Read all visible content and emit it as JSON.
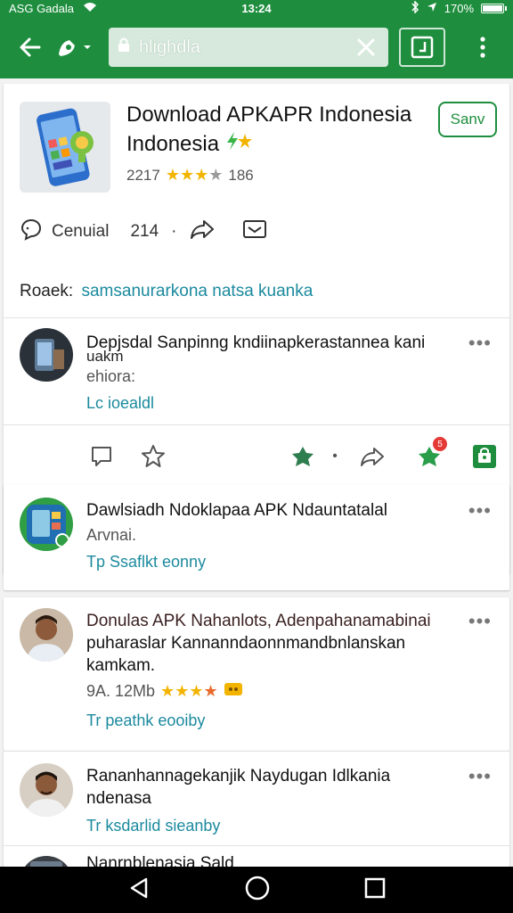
{
  "status_bar": {
    "carrier": "ASG Gadala",
    "time": "13:24",
    "battery": "170%"
  },
  "toolbar": {
    "url": "hlighdla"
  },
  "app": {
    "title_line1": "Download APKAPR Indonesia",
    "title_line2": "Indonesia",
    "rating_count": "2217",
    "rating_stars": 3,
    "rating_max": 5,
    "rating_extra": "186",
    "save_label": "Sanv",
    "comment_label": "Cenuial",
    "comment_count": "214",
    "read_label": "Roaek:",
    "read_link": "samsanurarkona natsa kuanka"
  },
  "posts": [
    {
      "title": "Depjsdal Sanpinng kndiinapkerastannea kani",
      "title2": "uakm",
      "sub": "ehiora:",
      "link": "Lc ioealdl"
    },
    {
      "title": "Dawlsiadh Ndoklapaa APK Ndauntatalal",
      "sub": "Arvnai.",
      "link": "Tp Ssaflkt eonny"
    },
    {
      "title": "Donulas APK Nahanlots, Adenpahanamabinai",
      "title2": "puharaslar Kannanndaonnmandbnlanskan",
      "title3": "kamkam.",
      "stats": "9A. 12Mb",
      "stars": 4,
      "link": "Tr peathk eooiby"
    },
    {
      "title": "Rananhannagekanjik Naydugan Idlkania",
      "title2": "ndenasa",
      "link": "Tr ksdarlid sieanby"
    },
    {
      "title": "Nanrnblenasia Sald"
    }
  ],
  "colors": {
    "brand_green": "#1e8e3e",
    "link_teal": "#1b8a9e",
    "star_gold": "#f2b400"
  }
}
